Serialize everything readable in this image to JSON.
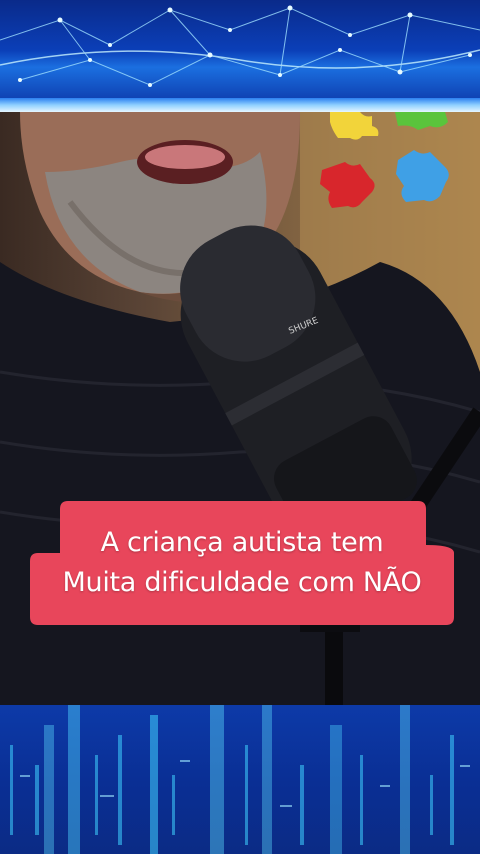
{
  "caption": {
    "line1": "A criança autista tem",
    "line2": "Muita dificuldade com NÃO"
  },
  "microphone": {
    "brand_text": "SHURE"
  },
  "colors": {
    "caption_background": "#e8465b",
    "banner_blue": "#0b3fb8",
    "puzzle_red": "#d8262c",
    "puzzle_blue": "#3fa0e6",
    "puzzle_yellow": "#f2d43a",
    "puzzle_green": "#5ac43c"
  },
  "icons": [
    "puzzle-piece-icon"
  ]
}
